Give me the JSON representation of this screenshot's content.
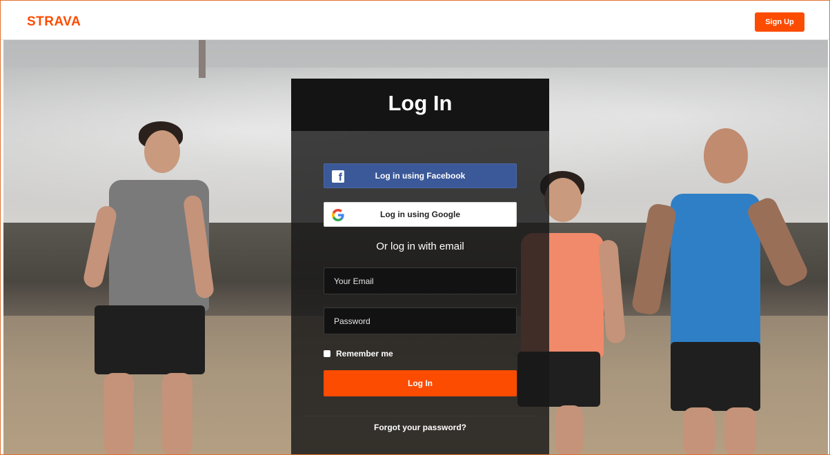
{
  "header": {
    "logo_text": "STRAVA",
    "signup_label": "Sign Up"
  },
  "login": {
    "title": "Log In",
    "facebook_label": "Log in using Facebook",
    "google_label": "Log in using Google",
    "or_text": "Or log in with email",
    "email_placeholder": "Your Email",
    "email_value": "",
    "password_placeholder": "Password",
    "password_value": "",
    "remember_label": "Remember me",
    "remember_checked": false,
    "submit_label": "Log In",
    "forgot_label": "Forgot your password?"
  },
  "icons": {
    "facebook": "facebook-icon",
    "google": "google-icon"
  },
  "colors": {
    "brand": "#fc4c02",
    "facebook": "#3b5998",
    "card_bg": "#191919"
  }
}
